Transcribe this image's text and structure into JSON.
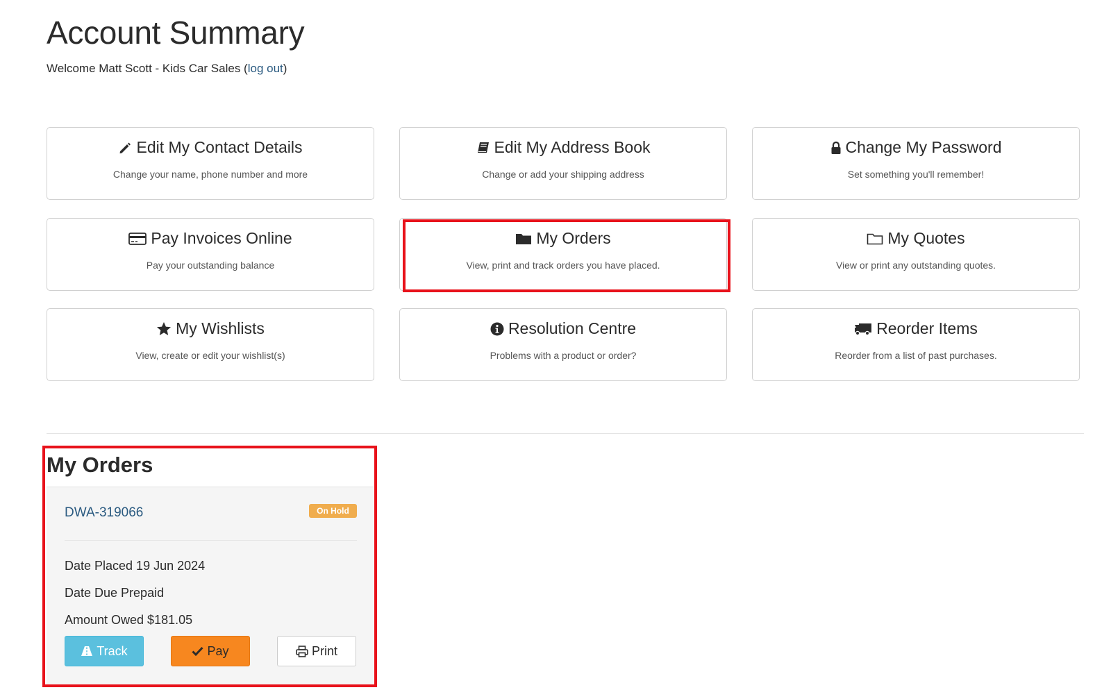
{
  "header": {
    "title": "Account Summary",
    "welcome_prefix": "Welcome Matt Scott - Kids Car Sales (",
    "logout_label": "log out",
    "welcome_suffix": ")"
  },
  "tiles": [
    {
      "title": "Edit My Contact Details",
      "description": "Change your name, phone number and more",
      "icon": "pencil-icon"
    },
    {
      "title": "Edit My Address Book",
      "description": "Change or add your shipping address",
      "icon": "book-icon"
    },
    {
      "title": "Change My Password",
      "description": "Set something you'll remember!",
      "icon": "lock-icon"
    },
    {
      "title": "Pay Invoices Online",
      "description": "Pay your outstanding balance",
      "icon": "credit-card-icon"
    },
    {
      "title": "My Orders",
      "description": "View, print and track orders you have placed.",
      "icon": "folder-icon"
    },
    {
      "title": "My Quotes",
      "description": "View or print any outstanding quotes.",
      "icon": "folder-outline-icon"
    },
    {
      "title": "My Wishlists",
      "description": "View, create or edit your wishlist(s)",
      "icon": "star-icon"
    },
    {
      "title": "Resolution Centre",
      "description": "Problems with a product or order?",
      "icon": "info-circle-icon"
    },
    {
      "title": "Reorder Items",
      "description": "Reorder from a list of past purchases.",
      "icon": "truck-icon"
    }
  ],
  "orders": {
    "heading": "My Orders",
    "order_id": "DWA-319066",
    "status": "On Hold",
    "date_placed": "Date Placed 19 Jun 2024",
    "date_due": "Date Due Prepaid",
    "amount_owed": "Amount Owed $181.05",
    "track_label": "Track",
    "pay_label": "Pay",
    "print_label": "Print"
  },
  "colors": {
    "highlight": "#e8121b",
    "link": "#2a5a80",
    "status_badge": "#f0ad4e",
    "track_button": "#5bc0de",
    "pay_button": "#f7871f"
  }
}
